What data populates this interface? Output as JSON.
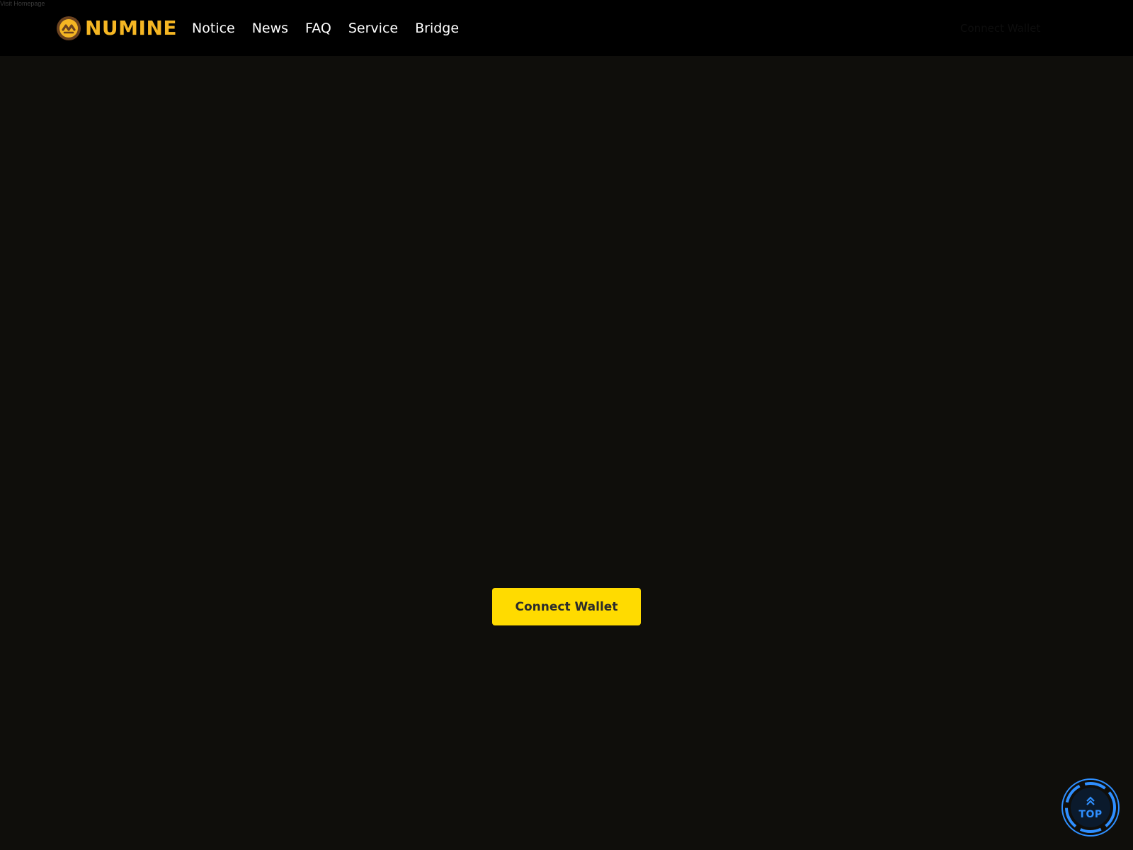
{
  "top_link": {
    "label": "Visit Homepage"
  },
  "brand": {
    "name": "NUMINE",
    "accent_color": "#f5b623",
    "logo_icon": "numine-logo-icon"
  },
  "nav": {
    "items": [
      {
        "label": "Notice"
      },
      {
        "label": "News"
      },
      {
        "label": "FAQ"
      },
      {
        "label": "Service"
      },
      {
        "label": "Bridge"
      }
    ]
  },
  "header_right": {
    "label": "Connect Wallet"
  },
  "main": {
    "connect_button": {
      "label": "Connect Wallet",
      "color": "#ffdb00"
    }
  },
  "scroll_top": {
    "label": "TOP",
    "icon": "double-chevron-up-icon",
    "color": "#2f8fff"
  }
}
